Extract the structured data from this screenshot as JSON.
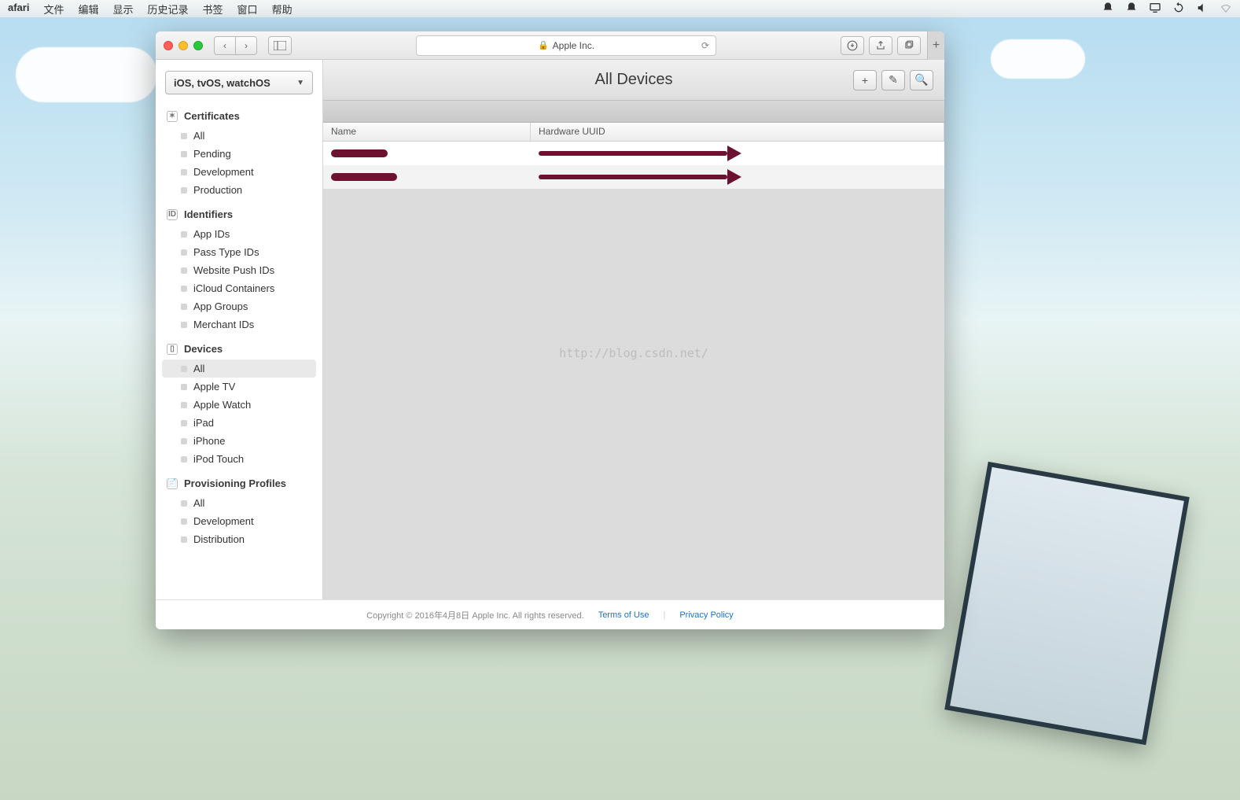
{
  "menubar": {
    "app": "afari",
    "items": [
      "文件",
      "编辑",
      "显示",
      "历史记录",
      "书签",
      "窗口",
      "帮助"
    ]
  },
  "window": {
    "url_label": "Apple Inc.",
    "platform_selector": "iOS, tvOS, watchOS"
  },
  "sidebar": {
    "sections": [
      {
        "title": "Certificates",
        "items": [
          "All",
          "Pending",
          "Development",
          "Production"
        ]
      },
      {
        "title": "Identifiers",
        "items": [
          "App IDs",
          "Pass Type IDs",
          "Website Push IDs",
          "iCloud Containers",
          "App Groups",
          "Merchant IDs"
        ]
      },
      {
        "title": "Devices",
        "items": [
          "All",
          "Apple TV",
          "Apple Watch",
          "iPad",
          "iPhone",
          "iPod Touch"
        ],
        "selected": 0
      },
      {
        "title": "Provisioning Profiles",
        "items": [
          "All",
          "Development",
          "Distribution"
        ]
      }
    ]
  },
  "main": {
    "title": "All Devices",
    "columns": [
      "Name",
      "Hardware UUID"
    ],
    "rows": [
      {
        "name": "[redacted]",
        "uuid": "[redacted]"
      },
      {
        "name": "[redacted]",
        "uuid": "[redacted]"
      }
    ],
    "watermark": "http://blog.csdn.net/"
  },
  "footer": {
    "copyright": "Copyright © 2016年4月8日 Apple Inc. All rights reserved.",
    "links": [
      "Terms of Use",
      "Privacy Policy"
    ]
  }
}
